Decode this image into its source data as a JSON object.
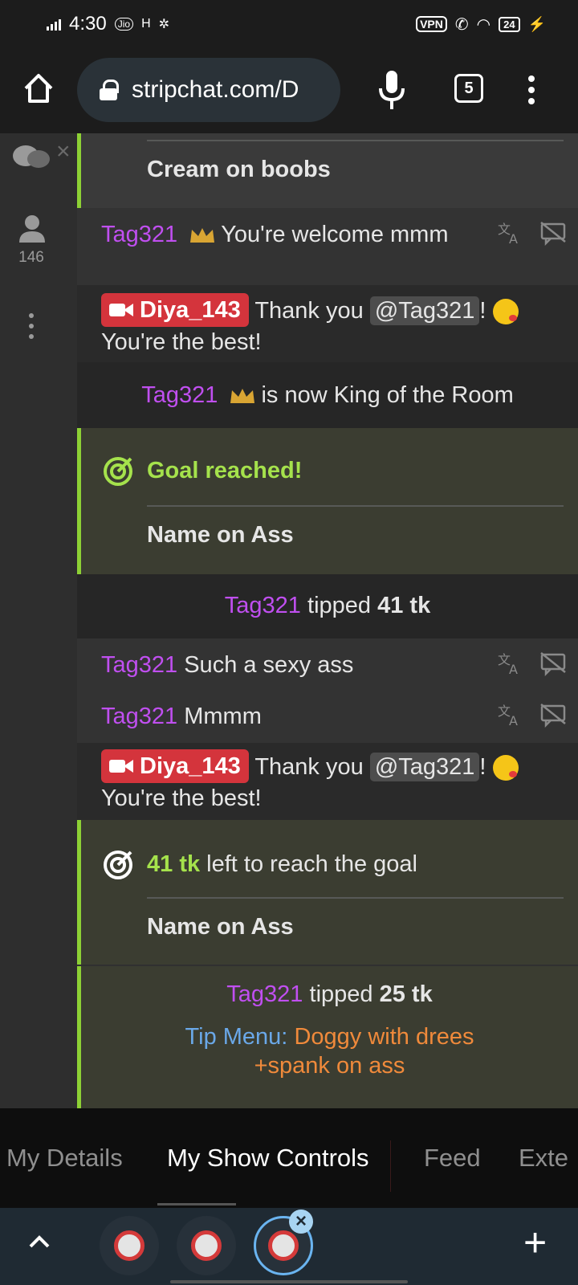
{
  "status_bar": {
    "time": "4:30",
    "carrier_badge": "Jio",
    "network": "H",
    "vpn": "VPN",
    "battery": "24"
  },
  "browser": {
    "url": "stripchat.com/D",
    "tab_count": "5"
  },
  "rail": {
    "viewer_count": "146"
  },
  "chat": {
    "top_goal": "Cream on boobs",
    "msg1": {
      "user": "Tag321",
      "text": "You're welcome mmm"
    },
    "model1": {
      "user": "Diya_143",
      "pre": "Thank you",
      "mention": "@Tag321",
      "post": "!",
      "line2": "You're the best!"
    },
    "king": {
      "user": "Tag321",
      "text": "is now King of the Room"
    },
    "goal1": {
      "title": "Goal reached!",
      "name": "Name on Ass"
    },
    "tip1": {
      "user": "Tag321",
      "verb": "tipped",
      "amount": "41 tk"
    },
    "msg2": {
      "user": "Tag321",
      "text": "Such a sexy ass"
    },
    "msg3": {
      "user": "Tag321",
      "text": "Mmmm"
    },
    "model2": {
      "user": "Diya_143",
      "pre": "Thank you",
      "mention": "@Tag321",
      "post": "!",
      "line2": "You're the best!"
    },
    "goal2": {
      "amount": "41 tk",
      "text": "left to reach the goal",
      "name": "Name on Ass"
    },
    "tip2": {
      "user": "Tag321",
      "verb": "tipped",
      "amount": "25 tk",
      "menu_label": "Tip Menu:",
      "menu_item": "Doggy with drees +spank on ass"
    }
  },
  "bottom_tabs": [
    "My Details",
    "My Show Controls",
    "Feed",
    "Exte"
  ],
  "colors": {
    "username": "#c04ff0",
    "model_badge": "#d4343c",
    "goal_accent": "#8dd135",
    "tip_menu": "#6aa8e8",
    "tip_item": "#f08a3b"
  }
}
